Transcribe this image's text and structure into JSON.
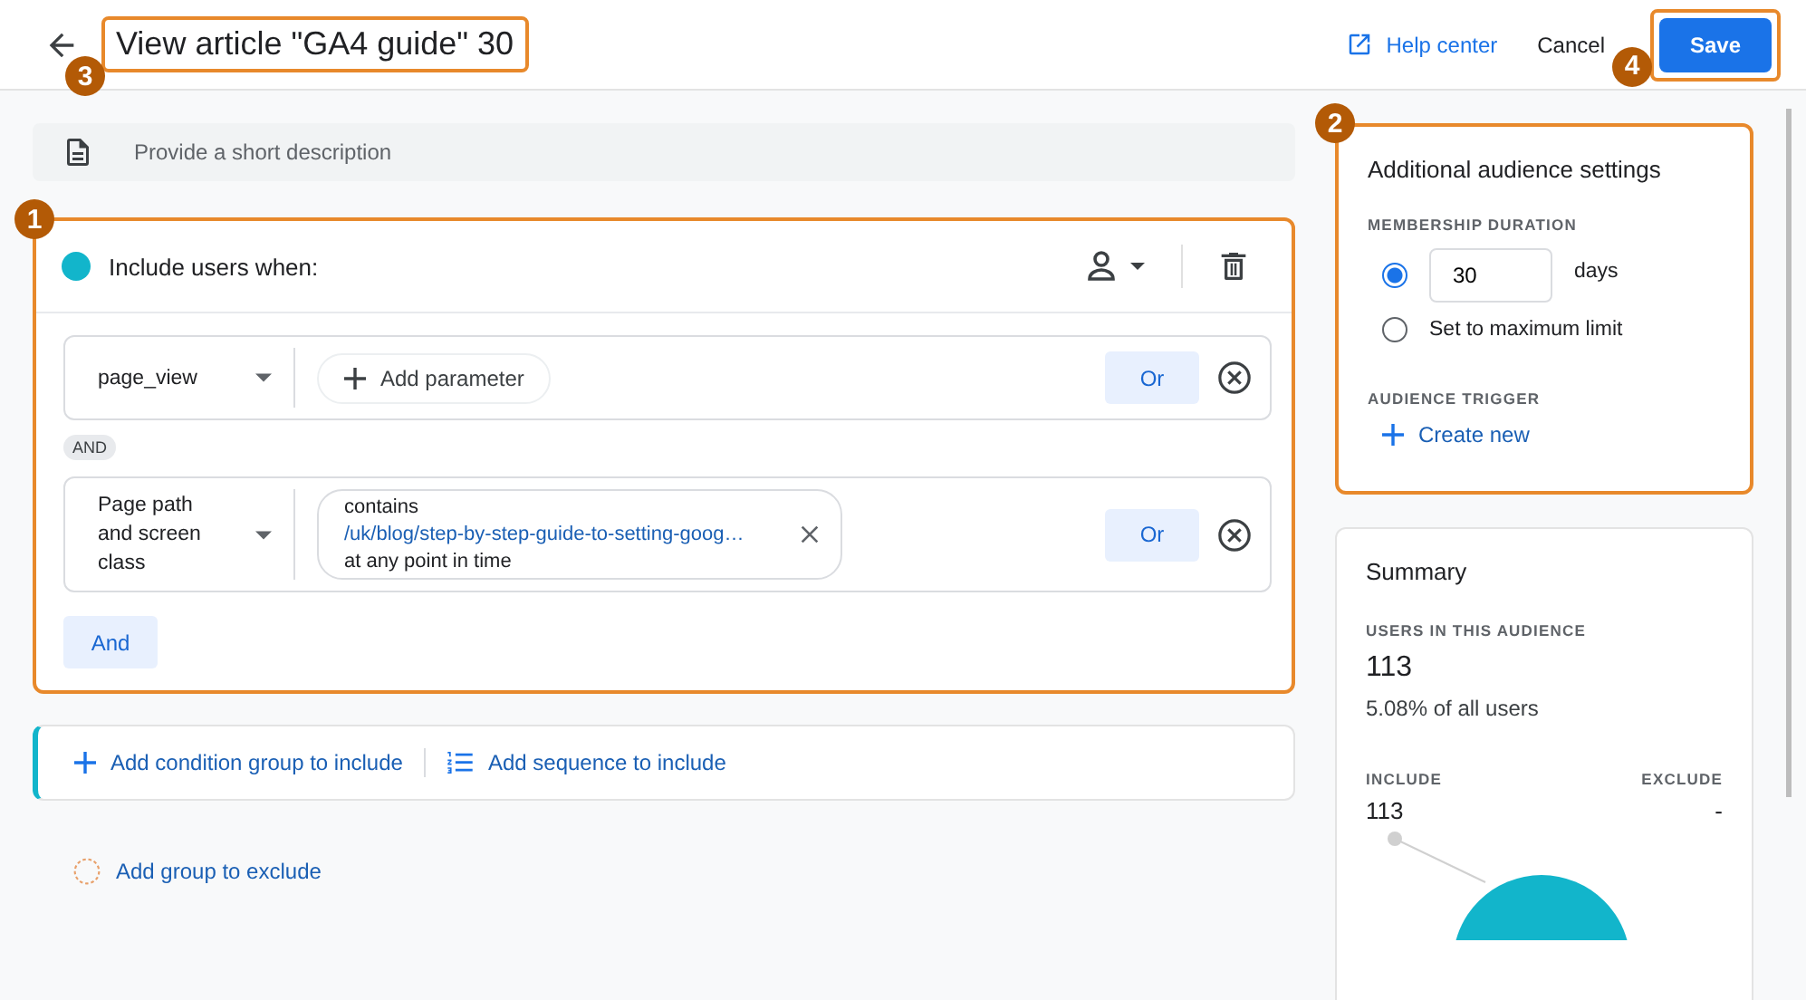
{
  "header": {
    "title": "View article \"GA4 guide\" 30",
    "title_callout": "3",
    "help_link": "Help center",
    "cancel": "Cancel",
    "save": "Save",
    "save_callout": "4"
  },
  "description": {
    "placeholder": "Provide a short description"
  },
  "include_group": {
    "callout": "1",
    "title": "Include users when:",
    "color": "#12b5cb",
    "conditions": [
      {
        "kind": "parameter",
        "dimension": "page_view",
        "add_label": "Add parameter",
        "or": "Or"
      },
      {
        "kind": "filter",
        "dimension": "Page path and screen class",
        "operator": "contains",
        "value": "/uk/blog/step-by-step-guide-to-setting-goog…",
        "scope": "at any point in time",
        "or": "Or"
      }
    ],
    "joiner": "AND",
    "and_button": "And"
  },
  "add_bar": {
    "condition": "Add condition group to include",
    "sequence": "Add sequence to include"
  },
  "exclude": "Add group to exclude",
  "audience_settings": {
    "callout": "2",
    "title": "Additional audience settings",
    "duration_label": "MEMBERSHIP DURATION",
    "options": [
      {
        "kind": "days",
        "value": "30",
        "unit": "days",
        "selected": true
      },
      {
        "kind": "max",
        "label": "Set to maximum limit",
        "selected": false
      }
    ],
    "trigger_label": "AUDIENCE TRIGGER",
    "create": "Create new"
  },
  "summary": {
    "title": "Summary",
    "users_label": "USERS IN THIS AUDIENCE",
    "users": "113",
    "share": "5.08% of all users",
    "include_label": "INCLUDE",
    "exclude_label": "EXCLUDE",
    "include": "113",
    "exclude": "-"
  }
}
